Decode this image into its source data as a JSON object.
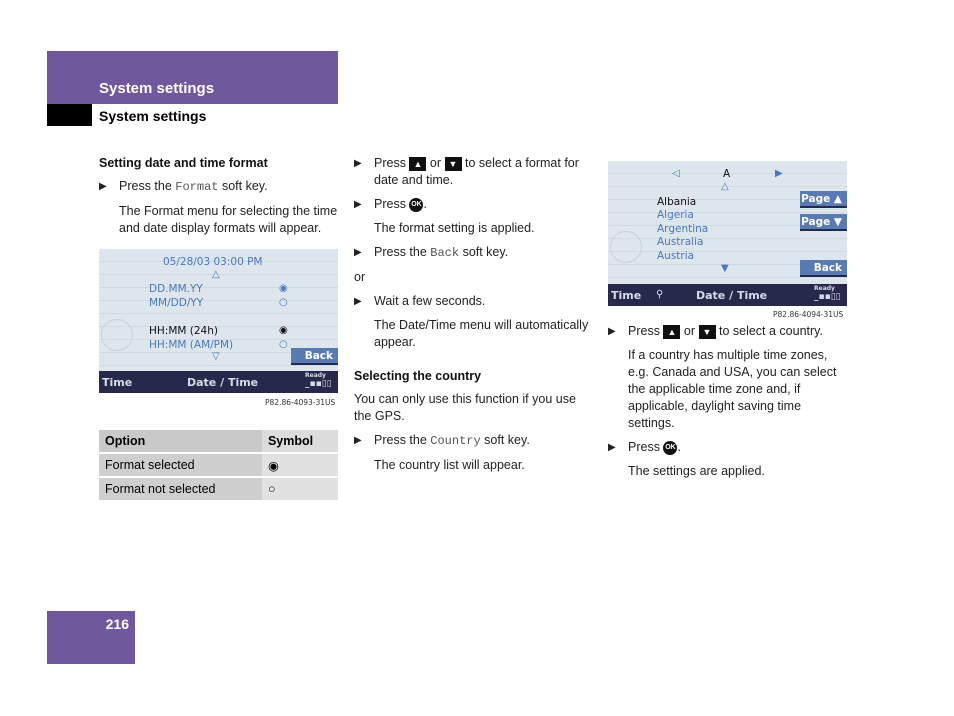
{
  "header": {
    "section_title": "System settings",
    "subsection_title": "System settings"
  },
  "col1": {
    "heading": "Setting date and time format",
    "step1_pre": "Press the ",
    "step1_key": "Format",
    "step1_post": " soft key.",
    "step1_result": "The Format menu for selecting the time and date display formats will appear.",
    "screen": {
      "datetime": "05/28/03 03:00 PM",
      "up_arrow": "△",
      "down_arrow": "▽",
      "rows": [
        {
          "label": "DD.MM.YY",
          "symbol": "◉"
        },
        {
          "label": "MM/DD/YY",
          "symbol": "○"
        },
        {
          "label": "HH:MM (24h)",
          "symbol": "◉"
        },
        {
          "label": "HH:MM (AM/PM)",
          "symbol": "○"
        }
      ],
      "back_button": "Back",
      "footer_left": "Time",
      "footer_center": "Date / Time",
      "footer_status": "Ready",
      "signal": "_▪▪▯▯",
      "code": "P82.86-4093-31US"
    },
    "table": {
      "headers": [
        "Option",
        "Symbol"
      ],
      "rows": [
        [
          "Format selected",
          "◉"
        ],
        [
          "Format not selected",
          "○"
        ]
      ]
    }
  },
  "col2": {
    "step1_pre": "Press ",
    "up_key": "▲",
    "or": " or ",
    "down_key": "▼",
    "step1_post": " to select a format for date and time.",
    "step2_pre": "Press ",
    "ok_key": "OK",
    "step2_post": ".",
    "step2_result": "The format setting is applied.",
    "step3_pre": "Press the ",
    "step3_key": "Back",
    "step3_post": " soft key.",
    "or_text": "or",
    "step4": "Wait a few seconds.",
    "step4_result": "The Date/Time menu will automatically appear.",
    "heading2": "Selecting the country",
    "intro2": "You can only use this function if you use the GPS.",
    "step5_pre": "Press the ",
    "step5_key": "Country",
    "step5_post": " soft key.",
    "step5_result": "The country list will appear."
  },
  "col3": {
    "screen": {
      "left_arrow": "◁",
      "letter": "A",
      "right_arrow": "▶",
      "up_arrow": "△",
      "down_arrow": "▼",
      "countries": [
        "Albania",
        "Algeria",
        "Argentina",
        "Australia",
        "Austria"
      ],
      "page_up": "Page ▲",
      "page_down": "Page ▼",
      "back_button": "Back",
      "footer_left": "Time",
      "footer_center": "Date / Time",
      "footer_status": "Ready",
      "signal": "_▪▪▯▯",
      "code": "P82.86-4094-31US"
    },
    "step1_pre": "Press ",
    "up_key": "▲",
    "or": " or ",
    "down_key": "▼",
    "step1_post": " to select a country.",
    "step1_result": "If a country has multiple time zones, e.g. Canada and USA, you can select the applicable time zone and, if applicable, daylight saving time settings.",
    "step2_pre": "Press ",
    "ok_key": "OK",
    "step2_post": ".",
    "step2_result": "The settings are applied."
  },
  "page_number": "216"
}
